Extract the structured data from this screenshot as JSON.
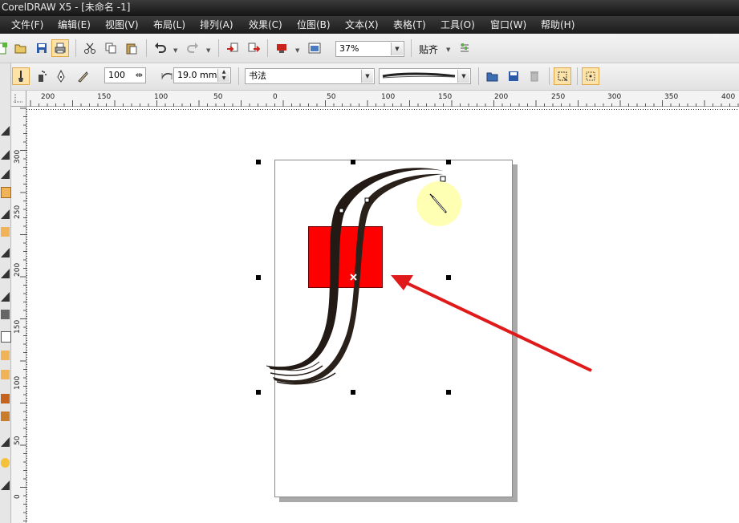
{
  "window": {
    "title": "CorelDRAW X5 - [未命名 -1]"
  },
  "menu": [
    {
      "key": "file",
      "label": "文件(F)"
    },
    {
      "key": "edit",
      "label": "编辑(E)"
    },
    {
      "key": "view",
      "label": "视图(V)"
    },
    {
      "key": "layout",
      "label": "布局(L)"
    },
    {
      "key": "arrange",
      "label": "排列(A)"
    },
    {
      "key": "effects",
      "label": "效果(C)"
    },
    {
      "key": "bitmaps",
      "label": "位图(B)"
    },
    {
      "key": "text",
      "label": "文本(X)"
    },
    {
      "key": "table",
      "label": "表格(T)"
    },
    {
      "key": "tools",
      "label": "工具(O)"
    },
    {
      "key": "window",
      "label": "窗口(W)"
    },
    {
      "key": "help",
      "label": "帮助(H)"
    }
  ],
  "toolbar": {
    "icons": [
      "new-icon",
      "open-icon",
      "save-icon",
      "print-icon",
      "cut-icon",
      "copy-icon",
      "paste-icon",
      "undo-icon",
      "redo-icon",
      "import-icon",
      "export-icon",
      "application-launcher-icon",
      "welcome-screen-icon",
      "options-icon"
    ],
    "zoom_value": "37%",
    "snap_label": "贴齐"
  },
  "propertybar": {
    "icons": [
      "preset-mode-icon",
      "brush-mode-icon",
      "sprayer-mode-icon",
      "calligraphic-mode-icon",
      "pressure-mode-icon",
      "browse-icon",
      "save-stroke-icon",
      "delete-stroke-icon",
      "scale-with-object-icon",
      "bounding-box-icon"
    ],
    "smoothing_value": "100",
    "width_value": "19.0 mm",
    "category_value": "书法"
  },
  "rulers": {
    "horizontal": [
      "200",
      "150",
      "100",
      "50",
      "0",
      "50",
      "100",
      "150",
      "200",
      "250",
      "300",
      "350",
      "400"
    ],
    "vertical": [
      "300",
      "250",
      "200",
      "150",
      "100",
      "50",
      "0"
    ]
  },
  "colors": {
    "accent": "#ff0000",
    "stroke": "#231a15",
    "highlight": "#fde3a8",
    "menubar": "#262626",
    "cursor_glow": "#ffff99"
  }
}
